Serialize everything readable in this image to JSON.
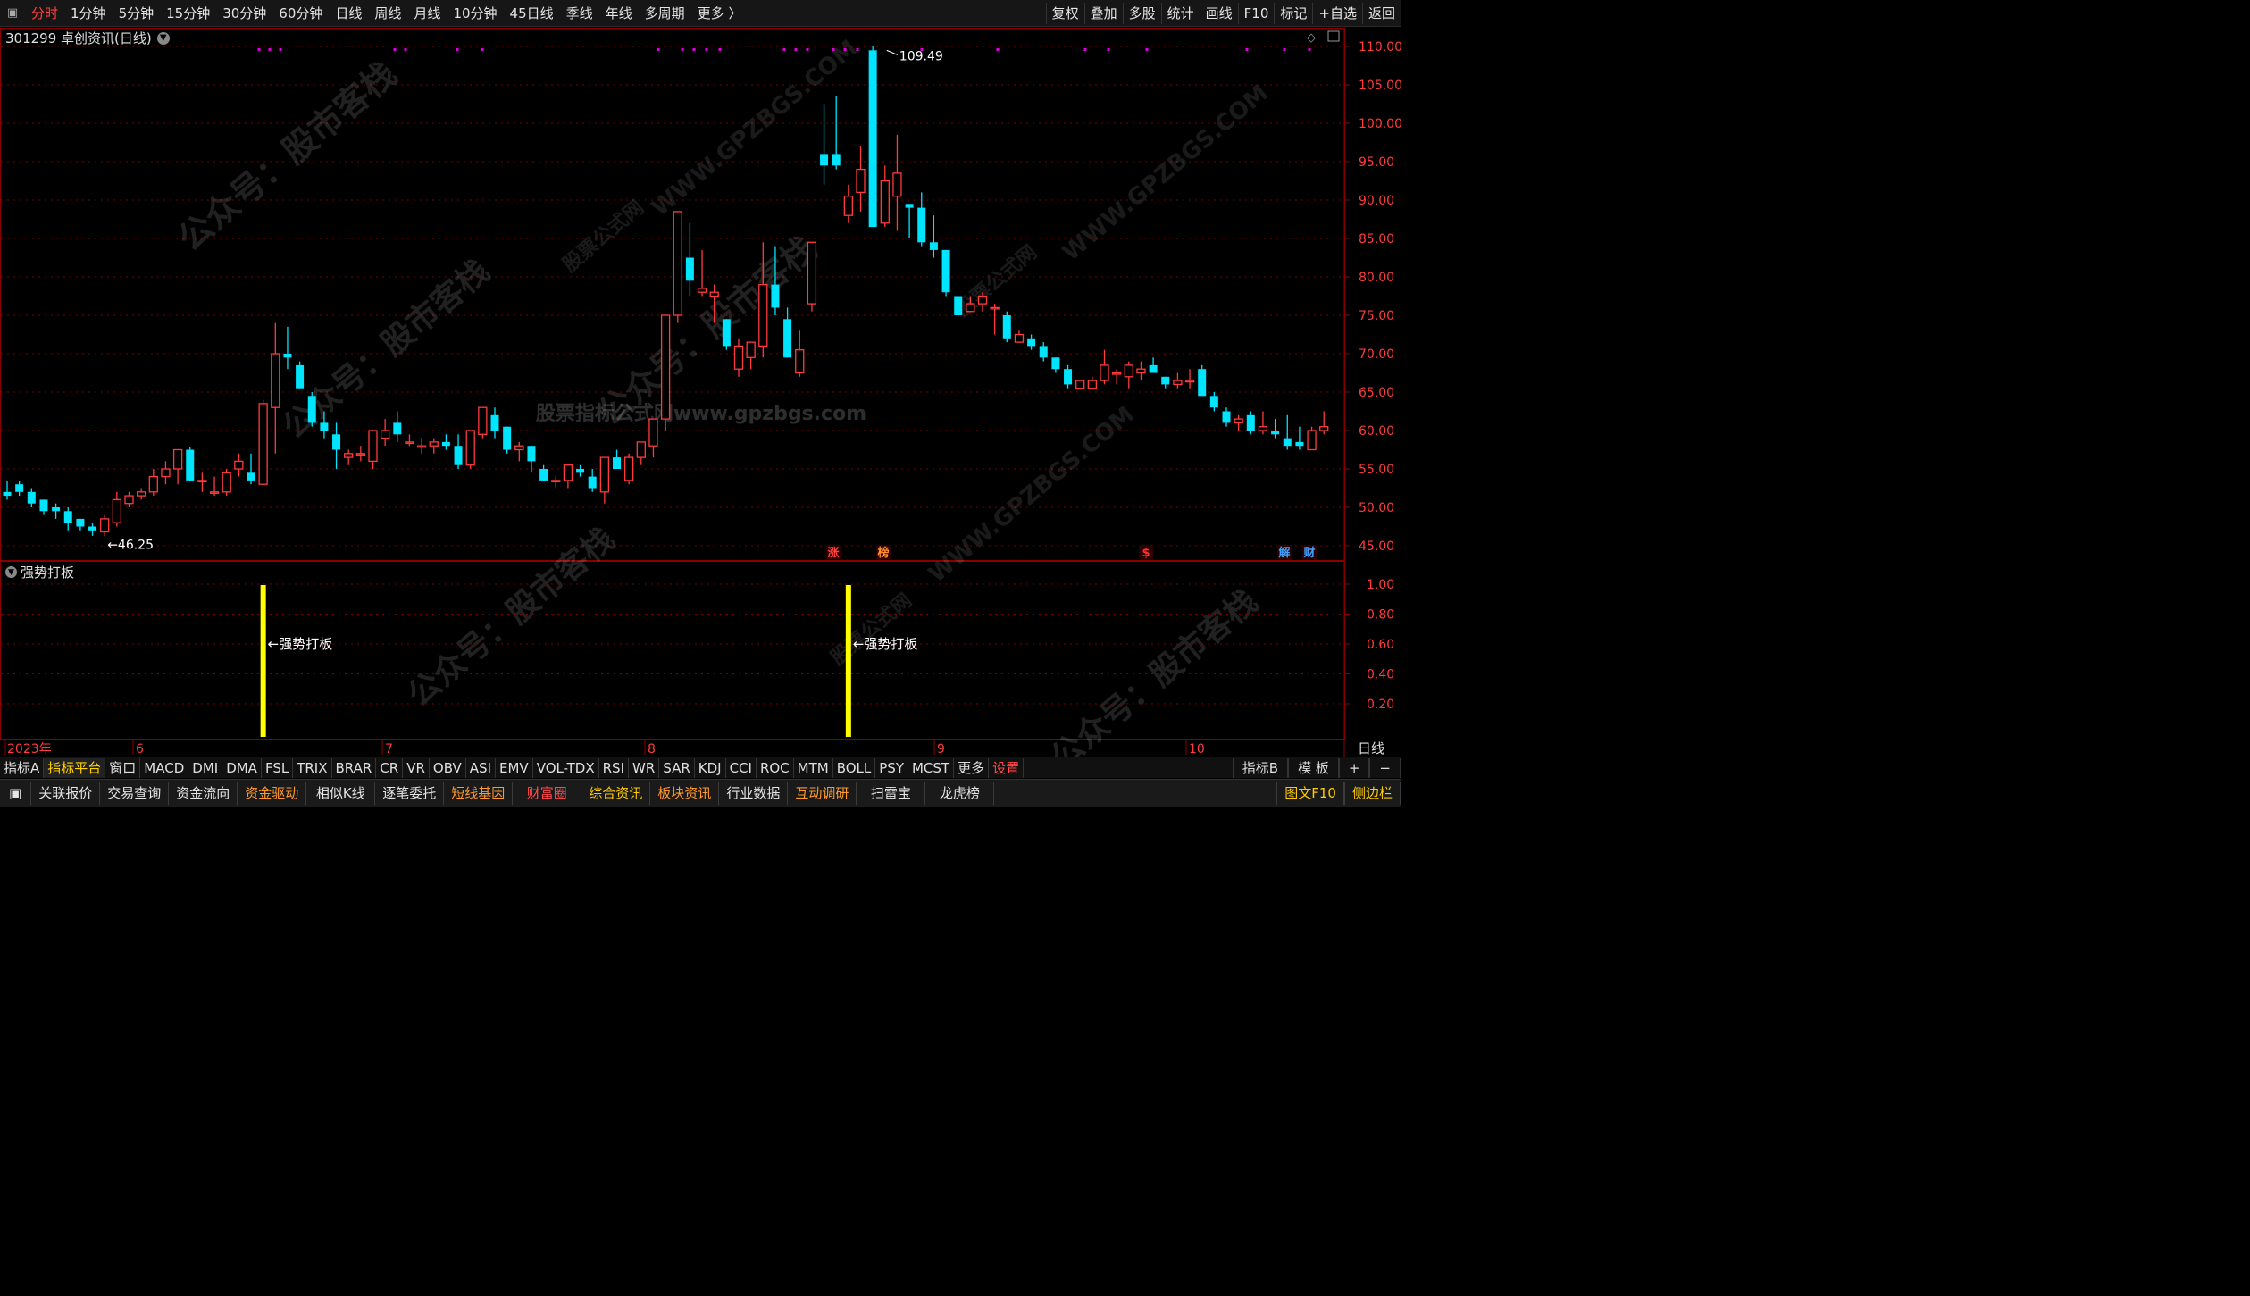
{
  "toolbar": {
    "periods": [
      "分时",
      "1分钟",
      "5分钟",
      "15分钟",
      "30分钟",
      "60分钟",
      "日线",
      "周线",
      "月线",
      "10分钟",
      "45日线",
      "季线",
      "年线",
      "多周期",
      "更多 〉"
    ],
    "right_buttons": [
      "复权",
      "叠加",
      "多股",
      "统计",
      "画线",
      "F10",
      "标记",
      "+自选",
      "返回"
    ]
  },
  "stock": {
    "title": "301299 卓创资讯(日线)"
  },
  "price_axis": {
    "ticks": [
      "110.00",
      "105.00",
      "100.00",
      "95.00",
      "90.00",
      "85.00",
      "80.00",
      "75.00",
      "70.00",
      "65.00",
      "60.00",
      "55.00",
      "50.00",
      "45.00"
    ]
  },
  "annotations": {
    "high_label": "109.49",
    "low_label": "46.25"
  },
  "event_markers": [
    {
      "label": "涨",
      "color": "#ff4040"
    },
    {
      "label": "榜",
      "color": "#ff9030"
    },
    {
      "label": "$",
      "color": "#ff3030"
    },
    {
      "label": "解",
      "color": "#40a0ff"
    },
    {
      "label": "财",
      "color": "#40a0ff"
    }
  ],
  "indicator": {
    "name": "强势打板",
    "ticks": [
      "1.00",
      "0.80",
      "0.60",
      "0.40",
      "0.20"
    ],
    "signal_label": "←强势打板"
  },
  "date_axis": {
    "labels": [
      "2023年",
      "6",
      "7",
      "8",
      "9",
      "10"
    ],
    "period_label": "日线"
  },
  "watermarks": [
    "公众号：股市客栈",
    "WWW.GPZBGS.COM",
    "股票公式网",
    "股票指标公式网www.gpzbgs.com"
  ],
  "indicator_tabs": [
    "指标A",
    "指标平台",
    "窗口",
    "MACD",
    "DMI",
    "DMA",
    "FSL",
    "TRIX",
    "BRAR",
    "CR",
    "VR",
    "OBV",
    "ASI",
    "EMV",
    "VOL-TDX",
    "RSI",
    "WR",
    "SAR",
    "KDJ",
    "CCI",
    "ROC",
    "MTM",
    "BOLL",
    "PSY",
    "MCST",
    "更多",
    "设置"
  ],
  "indicator_tabs_right": [
    "指标B",
    "模 板",
    "+",
    "−"
  ],
  "bottom_buttons": [
    "关联报价",
    "交易查询",
    "资金流向",
    "资金驱动",
    "相似K线",
    "逐笔委托",
    "短线基因",
    "财富圈",
    "综合资讯",
    "板块资讯",
    "行业数据",
    "互动调研",
    "扫雷宝",
    "龙虎榜"
  ],
  "bottom_right": [
    "图文F10",
    "侧边栏"
  ],
  "colors": {
    "up": "#ff3b3b",
    "down": "#00e5ff",
    "signal": "#ffff00",
    "grid": "#7a0000",
    "marker_dots": "#e000e0"
  },
  "chart_data": {
    "type": "candlestick",
    "title": "301299 卓创资讯(日线)",
    "ylim": [
      45,
      111
    ],
    "signal_days": [
      21,
      69
    ],
    "candles": [
      [
        52,
        53.5,
        51,
        51.5
      ],
      [
        53,
        53.5,
        51.5,
        52
      ],
      [
        52,
        52.5,
        50,
        50.5
      ],
      [
        51,
        51,
        49,
        49.5
      ],
      [
        50,
        50.5,
        48.5,
        49.5
      ],
      [
        49.5,
        50,
        47,
        48
      ],
      [
        48.5,
        48.5,
        47,
        47.5
      ],
      [
        47.5,
        48,
        46.3,
        47
      ],
      [
        46.8,
        49,
        46.25,
        48.5
      ],
      [
        48,
        52,
        47.5,
        51
      ],
      [
        50.5,
        52,
        50,
        51.5
      ],
      [
        51.5,
        52.5,
        51,
        52
      ],
      [
        52,
        55,
        51.5,
        54
      ],
      [
        54,
        56,
        53,
        55
      ],
      [
        55,
        57,
        53,
        57.5
      ],
      [
        57.5,
        57.8,
        53.5,
        53.5
      ],
      [
        53.5,
        54.5,
        52,
        53.5
      ],
      [
        52,
        54,
        51.5,
        52
      ],
      [
        52,
        55,
        51.5,
        54.5
      ],
      [
        55,
        57,
        54,
        56
      ],
      [
        54.5,
        57,
        53,
        53.5
      ],
      [
        53,
        64,
        53,
        63.5
      ],
      [
        63,
        74,
        57,
        70
      ],
      [
        70,
        73.5,
        68,
        69.5
      ],
      [
        68.5,
        69,
        65.5,
        65.5
      ],
      [
        64.5,
        65,
        60.5,
        61
      ],
      [
        61,
        62.5,
        59,
        60
      ],
      [
        59.5,
        61,
        55,
        57.5
      ],
      [
        56.5,
        57.5,
        55.5,
        57
      ],
      [
        57,
        58,
        56,
        57
      ],
      [
        56,
        60,
        55,
        60
      ],
      [
        59,
        61.5,
        58,
        60
      ],
      [
        61,
        62.5,
        58.5,
        59.5
      ],
      [
        58.5,
        59.5,
        58,
        58.5
      ],
      [
        58,
        59,
        57,
        58
      ],
      [
        58,
        59,
        57,
        58.5
      ],
      [
        58.5,
        59.5,
        57.5,
        58
      ],
      [
        58,
        59.5,
        55,
        55.5
      ],
      [
        55.5,
        60,
        55,
        60
      ],
      [
        59.5,
        63,
        59,
        63
      ],
      [
        62,
        63,
        59,
        60
      ],
      [
        60.5,
        60.5,
        57,
        57.5
      ],
      [
        57.5,
        58.5,
        56,
        58
      ],
      [
        58,
        58,
        54.5,
        56
      ],
      [
        55,
        55.5,
        53.5,
        53.5
      ],
      [
        53.5,
        54,
        52.5,
        53.5
      ],
      [
        53.5,
        55.5,
        52.5,
        55.5
      ],
      [
        55,
        55.5,
        54,
        54.5
      ],
      [
        54,
        55,
        52,
        52.5
      ],
      [
        52,
        56.5,
        50.5,
        56.5
      ],
      [
        56.5,
        57.5,
        55,
        55
      ],
      [
        53.5,
        57,
        53,
        56.5
      ],
      [
        56.5,
        58.5,
        55.5,
        58.5
      ],
      [
        58,
        61.5,
        56.5,
        61.5
      ],
      [
        61.5,
        75,
        60,
        75
      ],
      [
        75,
        88,
        74,
        88.5
      ],
      [
        82.5,
        87,
        77.5,
        79.5
      ],
      [
        78,
        83.5,
        77.5,
        78.5
      ],
      [
        77.5,
        79,
        74,
        78
      ],
      [
        74.5,
        74.5,
        70.5,
        71
      ],
      [
        68,
        72,
        67,
        71
      ],
      [
        69.5,
        71.5,
        68,
        71.5
      ],
      [
        71,
        84.5,
        69.5,
        79
      ],
      [
        79,
        84,
        75,
        76
      ],
      [
        74.5,
        76,
        69.5,
        69.5
      ],
      [
        67.5,
        73,
        67,
        70.5
      ],
      [
        76.5,
        84,
        75.5,
        84.5
      ],
      [
        96,
        102.5,
        92,
        94.5
      ],
      [
        96,
        103.5,
        94,
        94.5
      ],
      [
        88,
        92,
        87,
        90.5
      ],
      [
        91,
        97,
        88.5,
        94
      ],
      [
        109.5,
        110,
        86.5,
        86.5
      ],
      [
        87,
        94.5,
        86.5,
        92.5
      ],
      [
        90.5,
        98.5,
        86,
        93.5
      ],
      [
        89.5,
        89.5,
        85,
        89
      ],
      [
        89,
        91,
        84,
        84.5
      ],
      [
        84.5,
        88,
        82.5,
        83.5
      ],
      [
        83.5,
        83.5,
        77.5,
        78
      ],
      [
        77.5,
        77.5,
        75.5,
        75
      ],
      [
        75.5,
        77.5,
        75.5,
        76.5
      ],
      [
        76.5,
        78,
        75.5,
        77.5
      ],
      [
        76,
        76.5,
        72.5,
        76
      ],
      [
        75,
        75.5,
        71.5,
        72
      ],
      [
        71.5,
        73,
        71.5,
        72.5
      ],
      [
        72,
        72.5,
        70.5,
        71
      ],
      [
        71,
        71.5,
        69,
        69.5
      ],
      [
        69.5,
        69.5,
        67.5,
        68
      ],
      [
        68,
        68.5,
        65.5,
        66
      ],
      [
        65.5,
        66.5,
        65.5,
        66.5
      ],
      [
        65.5,
        67,
        65.5,
        66.5
      ],
      [
        66.5,
        70.5,
        66,
        68.5
      ],
      [
        67.5,
        68,
        66,
        67.5
      ],
      [
        67,
        69,
        65.5,
        68.5
      ],
      [
        67.5,
        69,
        66.5,
        68
      ],
      [
        68.5,
        69.5,
        67.5,
        67.5
      ],
      [
        67,
        67,
        65.5,
        66
      ],
      [
        66,
        67.5,
        65.5,
        66.5
      ],
      [
        66.5,
        68,
        65.5,
        66.5
      ],
      [
        68,
        68.5,
        64.5,
        64.5
      ],
      [
        64.5,
        65,
        62.5,
        63
      ],
      [
        62.5,
        63,
        60.5,
        61
      ],
      [
        61,
        62,
        60,
        61.5
      ],
      [
        62,
        62.5,
        59.5,
        60
      ],
      [
        60,
        62.5,
        59.5,
        60.5
      ],
      [
        60,
        61.5,
        59,
        59.5
      ],
      [
        59,
        62,
        57.5,
        58
      ],
      [
        58.5,
        60.5,
        57.5,
        58
      ],
      [
        57.5,
        60.5,
        57.5,
        60
      ],
      [
        60,
        62.5,
        59.5,
        60.5
      ]
    ]
  }
}
